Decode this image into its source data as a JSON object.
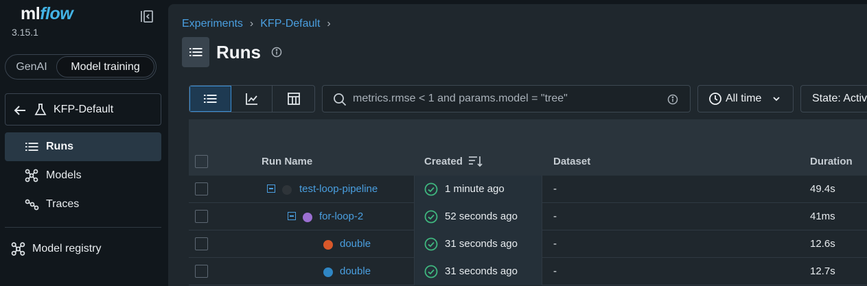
{
  "app": {
    "logo_prefix": "ml",
    "logo_suffix": "flow",
    "version": "3.15.1"
  },
  "sidebar": {
    "mode_options": [
      "GenAI",
      "Model training"
    ],
    "selected_mode": "Model training",
    "experiment_name": "KFP-Default",
    "nav": [
      {
        "label": "Runs",
        "icon": "list-icon",
        "active": true
      },
      {
        "label": "Models",
        "icon": "models-icon",
        "active": false
      },
      {
        "label": "Traces",
        "icon": "traces-icon",
        "active": false
      }
    ],
    "registry_label": "Model registry"
  },
  "breadcrumb": [
    "Experiments",
    "KFP-Default"
  ],
  "page": {
    "title": "Runs"
  },
  "toolbar": {
    "view_modes": [
      "list-view-icon",
      "chart-view-icon",
      "table-view-icon"
    ],
    "active_view": "list-view-icon",
    "search_placeholder": "metrics.rmse < 1 and params.model = \"tree\"",
    "search_value": "",
    "time_filter": "All time",
    "state_filter": "State: Activ"
  },
  "table": {
    "columns": [
      "Run Name",
      "Created",
      "Dataset",
      "Duration"
    ],
    "rows": [
      {
        "name": "test-loop-pipeline",
        "indent": 0,
        "expander": true,
        "dot_color": "#2e3439",
        "created": "1 minute ago",
        "dataset": "-",
        "duration": "49.4s"
      },
      {
        "name": "for-loop-2",
        "indent": 1,
        "expander": true,
        "dot_color": "#9b6fd1",
        "created": "52 seconds ago",
        "dataset": "-",
        "duration": "41ms"
      },
      {
        "name": "double",
        "indent": 2,
        "expander": false,
        "dot_color": "#d9582a",
        "created": "31 seconds ago",
        "dataset": "-",
        "duration": "12.6s"
      },
      {
        "name": "double",
        "indent": 2,
        "expander": false,
        "dot_color": "#2f86c4",
        "created": "31 seconds ago",
        "dataset": "-",
        "duration": "12.7s"
      }
    ]
  }
}
